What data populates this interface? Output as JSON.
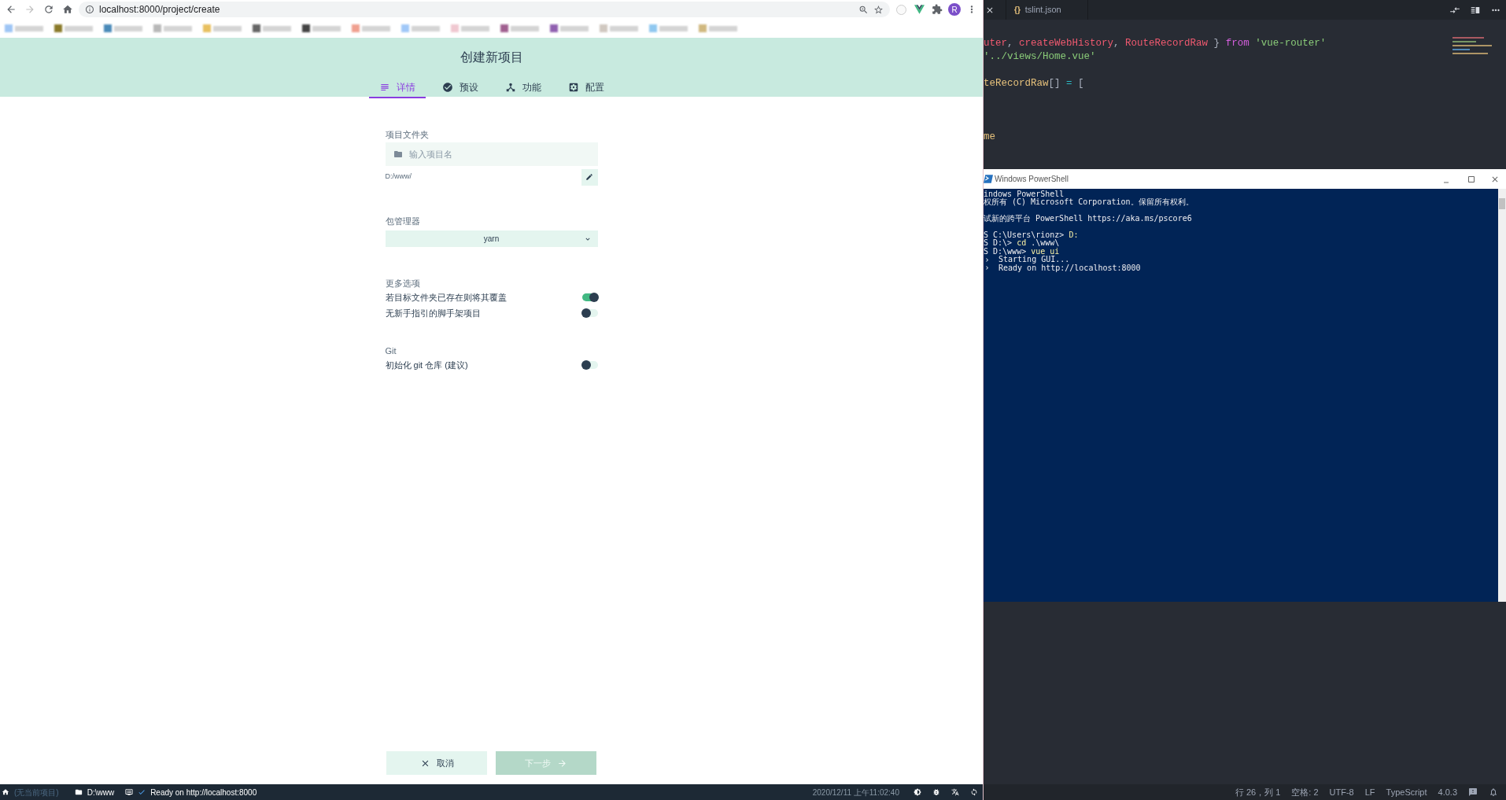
{
  "browser": {
    "url": "localhost:8000/project/create",
    "avatar": "R"
  },
  "page": {
    "title": "创建新项目",
    "tabs": [
      {
        "label": "详情",
        "selected": true
      },
      {
        "label": "预设",
        "selected": false
      },
      {
        "label": "功能",
        "selected": false
      },
      {
        "label": "配置",
        "selected": false
      }
    ],
    "folder": {
      "label": "项目文件夹",
      "placeholder": "输入项目名",
      "path": "D:/www/"
    },
    "package_manager": {
      "label": "包管理器",
      "value": "yarn"
    },
    "more_options": {
      "label": "更多选项",
      "toggles": [
        {
          "label": "若目标文件夹已存在则将其覆盖",
          "on": true
        },
        {
          "label": "无新手指引的脚手架项目",
          "on": false
        }
      ]
    },
    "git": {
      "label": "Git",
      "toggles": [
        {
          "label": "初始化 git 仓库 (建议)",
          "on": false
        }
      ]
    },
    "buttons": [
      {
        "label": "取消",
        "kind": "cancel",
        "disabled": false
      },
      {
        "label": "下一步",
        "kind": "next",
        "disabled": true
      }
    ]
  },
  "status_bar": {
    "project": "(无当前项目)",
    "folder": "D:\\www",
    "message": "Ready on http://localhost:8000",
    "time": "2020/12/11 上午11:02:40"
  },
  "editor": {
    "tab_glyph": "{}",
    "tab": "tslint.json",
    "code_lines": [
      [
        {
          "text": "uter",
          "kind": "name"
        },
        {
          "text": ", ",
          "kind": "plain"
        },
        {
          "text": "createWebHistory",
          "kind": "name"
        },
        {
          "text": ", ",
          "kind": "plain"
        },
        {
          "text": "RouteRecordRaw",
          "kind": "name"
        },
        {
          "text": " } ",
          "kind": "plain"
        },
        {
          "text": "from",
          "kind": "keyword"
        },
        {
          "text": " 'vue-router'",
          "kind": "string"
        }
      ],
      [
        {
          "text": "'../views/Home.vue'",
          "kind": "string"
        }
      ],
      [
        {
          "text": "teRecordRaw",
          "kind": "type"
        },
        {
          "text": "[]",
          "kind": "plain"
        },
        {
          "text": " = ",
          "kind": "operator"
        },
        {
          "text": "[",
          "kind": "plain"
        }
      ],
      [
        {
          "text": "me",
          "kind": "type"
        }
      ]
    ],
    "status": [
      "行 26，列 1",
      "空格: 2",
      "UTF-8",
      "LF",
      "TypeScript",
      "4.0.3"
    ]
  },
  "powershell": {
    "title": "Windows PowerShell",
    "lines": [
      [
        {
          "text": "indows PowerShell",
          "kind": "plain"
        }
      ],
      [
        {
          "text": "权所有 (C) Microsoft Corporation。保留所有权利。",
          "kind": "plain"
        }
      ],
      [
        {
          "text": "试新的跨平台 PowerShell https://aka.ms/pscore6",
          "kind": "plain"
        }
      ],
      [
        {
          "text": "S C:\\Users\\rionz> ",
          "kind": "plain"
        },
        {
          "text": "D:",
          "kind": "command"
        }
      ],
      [
        {
          "text": "S D:\\> ",
          "kind": "plain"
        },
        {
          "text": "cd",
          "kind": "command"
        },
        {
          "text": " .\\www\\",
          "kind": "plain"
        }
      ],
      [
        {
          "text": "S D:\\www> ",
          "kind": "plain"
        },
        {
          "text": "vue ui",
          "kind": "command"
        }
      ],
      [
        {
          "text": "Starting GUI...",
          "kind": "output"
        }
      ],
      [
        {
          "text": "Ready on http://localhost:8000",
          "kind": "output"
        }
      ]
    ]
  }
}
